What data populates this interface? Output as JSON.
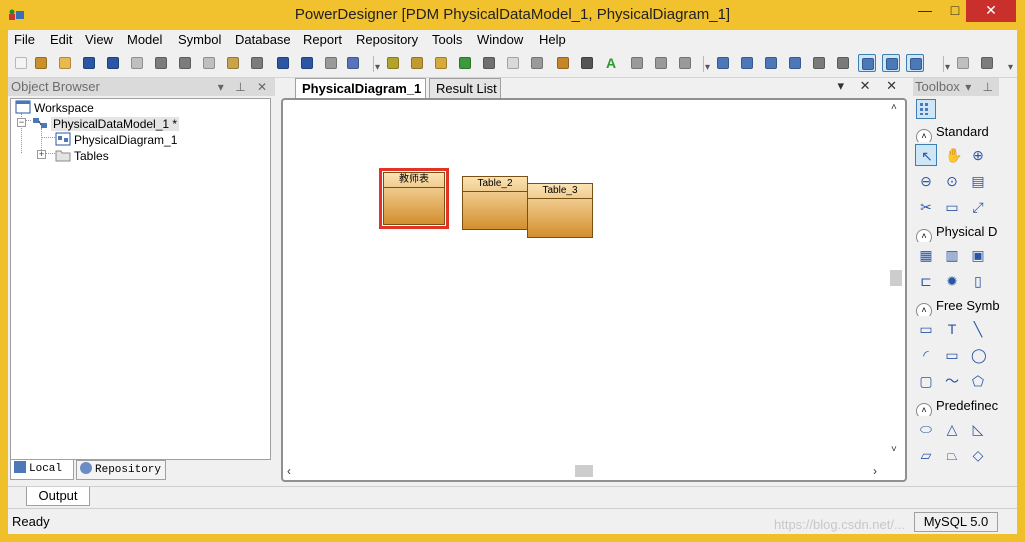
{
  "window": {
    "title": "PowerDesigner [PDM PhysicalDataModel_1, PhysicalDiagram_1]",
    "min_glyph": "—",
    "max_glyph": "□",
    "close_glyph": "✕"
  },
  "menu": [
    "File",
    "Edit",
    "View",
    "Model",
    "Symbol",
    "Database",
    "Report",
    "Repository",
    "Tools",
    "Window",
    "Help"
  ],
  "toolbar": {
    "buttons": [
      {
        "name": "new-icon",
        "color": "#f4f4f4"
      },
      {
        "name": "new-project-icon",
        "color": "#c9912c"
      },
      {
        "name": "open-icon",
        "color": "#e9b94d"
      },
      {
        "name": "save-icon",
        "color": "#2a56a4"
      },
      {
        "name": "save-all-icon",
        "color": "#2a56a4"
      },
      {
        "name": "print-preview-icon",
        "color": "#bfbfbf"
      },
      {
        "name": "print-icon",
        "color": "#7c7c7c"
      },
      {
        "name": "cut-icon",
        "color": "#7c7c7c"
      },
      {
        "name": "copy-icon",
        "color": "#bfbfbf"
      },
      {
        "name": "paste-icon",
        "color": "#c9a24c"
      },
      {
        "name": "delete-icon",
        "color": "#7c7c7c"
      },
      {
        "name": "undo-icon",
        "color": "#2a56a4"
      },
      {
        "name": "redo-icon",
        "color": "#2a56a4"
      },
      {
        "name": "properties-icon",
        "color": "#9a9a9a"
      },
      {
        "name": "check-model-icon",
        "color": "#5674b9"
      },
      {
        "name": "package-icon",
        "color": "#b3a32b"
      },
      {
        "name": "new-package-icon",
        "color": "#c29a33"
      },
      {
        "name": "find-icon",
        "color": "#d5a93a"
      },
      {
        "name": "refresh-icon",
        "color": "#3c9a3c"
      },
      {
        "name": "impact-icon",
        "color": "#6f6f6f"
      },
      {
        "name": "symbol-format-icon",
        "color": "#d9d9d9"
      },
      {
        "name": "grid-icon",
        "color": "#9a9a9a"
      },
      {
        "name": "brush-icon",
        "color": "#c5862a"
      },
      {
        "name": "pointer-tool-icon",
        "color": "#555555"
      },
      {
        "name": "text-color-icon",
        "color": "#2e9b2e",
        "text": "A"
      },
      {
        "name": "align-left-icon",
        "color": "#9a9a9a"
      },
      {
        "name": "align-back-icon",
        "color": "#9a9a9a"
      },
      {
        "name": "align-forward-icon",
        "color": "#9a9a9a"
      },
      {
        "name": "list-view-icon",
        "color": "#4a78b8"
      },
      {
        "name": "table-icon",
        "color": "#4a78b8"
      },
      {
        "name": "window-icon",
        "color": "#4a78b8"
      },
      {
        "name": "cascade-icon",
        "color": "#4a78b8"
      },
      {
        "name": "tile-icon",
        "color": "#7a7a7a"
      },
      {
        "name": "diagram-view-icon",
        "color": "#7a7a7a"
      },
      {
        "name": "zoom-window-icon",
        "color": "#4a78b8",
        "selected": true
      },
      {
        "name": "output-window-icon",
        "color": "#4a78b8",
        "selected": true
      },
      {
        "name": "result-list-icon",
        "color": "#4a78b8",
        "selected": true
      },
      {
        "name": "report-preview-icon",
        "color": "#bfbfbf"
      },
      {
        "name": "report-print-icon",
        "color": "#7c7c7c"
      }
    ]
  },
  "object_browser": {
    "title": "Object Browser",
    "controls": "▾ ⊥ ✕",
    "tree": {
      "workspace": "Workspace",
      "model": "PhysicalDataModel_1 *",
      "diagram": "PhysicalDiagram_1",
      "tables": "Tables"
    },
    "tabs": {
      "local": "Local",
      "repository": "Repository"
    }
  },
  "diagram": {
    "tabs": [
      "PhysicalDiagram_1",
      "Result List"
    ],
    "controls": "▾ ✕ ✕",
    "tables": [
      {
        "label": "教师表",
        "selected": true
      },
      {
        "label": "Table_2"
      },
      {
        "label": "Table_3"
      }
    ]
  },
  "toolbox": {
    "title": "Toolbox",
    "controls": "▾ ⊥",
    "groups": [
      {
        "label": "Standard",
        "tools": [
          "pointer-icon",
          "grabber-icon",
          "zoom-in-icon",
          "zoom-out-icon",
          "open-package-icon",
          "properties-tool-icon",
          "delete-tool-icon",
          "note-icon",
          "link-icon"
        ]
      },
      {
        "label": "Physical D",
        "tools": [
          "table-tool-icon",
          "view-tool-icon",
          "procedure-tool-icon",
          "reference-tool-icon",
          "trigger-tool-icon",
          "file-tool-icon"
        ]
      },
      {
        "label": "Free Symb",
        "tools": [
          "title-tool-icon",
          "text-tool-icon",
          "line-tool-icon",
          "arc-tool-icon",
          "rectangle-tool-icon",
          "ellipse-tool-icon",
          "rounded-rect-tool-icon",
          "polyline-tool-icon",
          "polygon-tool-icon"
        ]
      },
      {
        "label": "Predefinec",
        "tools": [
          "rounded-shape-icon",
          "triangle-shape-icon",
          "right-triangle-shape-icon",
          "parallelogram-shape-icon",
          "trapezoid-shape-icon",
          "diamond-shape-icon"
        ]
      }
    ]
  },
  "output": {
    "tab": "Output"
  },
  "status": {
    "text": "Ready",
    "dbms": "MySQL 5.0",
    "watermark": "https://blog.csdn.net/..."
  }
}
